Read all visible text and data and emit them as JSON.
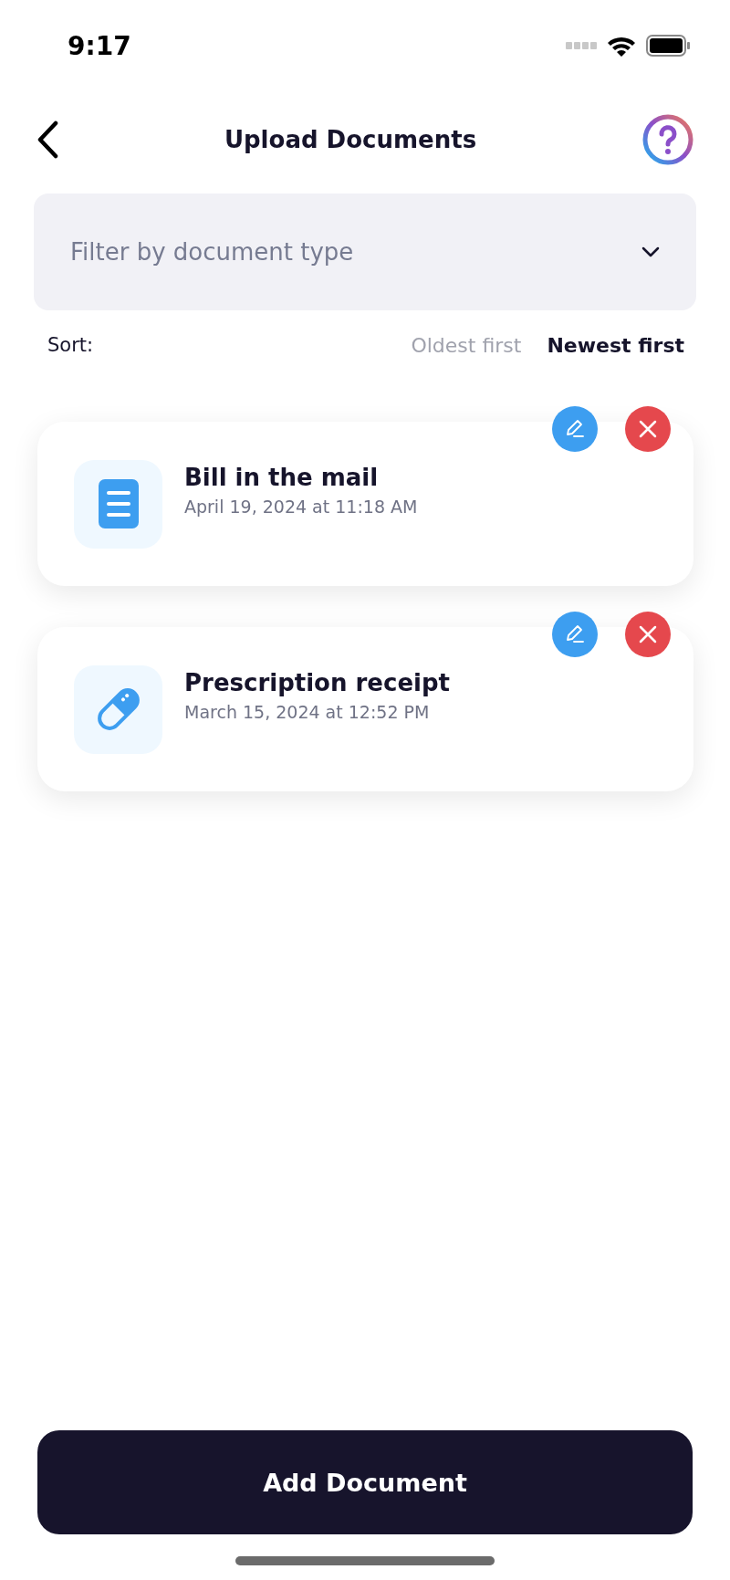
{
  "status_bar": {
    "time": "9:17"
  },
  "header": {
    "title": "Upload Documents"
  },
  "filter": {
    "placeholder": "Filter by document type"
  },
  "sort": {
    "label": "Sort:",
    "options": [
      {
        "label": "Oldest first",
        "selected": false
      },
      {
        "label": "Newest first",
        "selected": true
      }
    ]
  },
  "documents": [
    {
      "kind": "bill",
      "title": "Bill in the mail",
      "date": "April 19, 2024 at 11:18 AM"
    },
    {
      "kind": "pill",
      "title": "Prescription receipt",
      "date": "March 15, 2024 at 12:52 PM"
    }
  ],
  "primary_button": {
    "label": "Add Document"
  }
}
